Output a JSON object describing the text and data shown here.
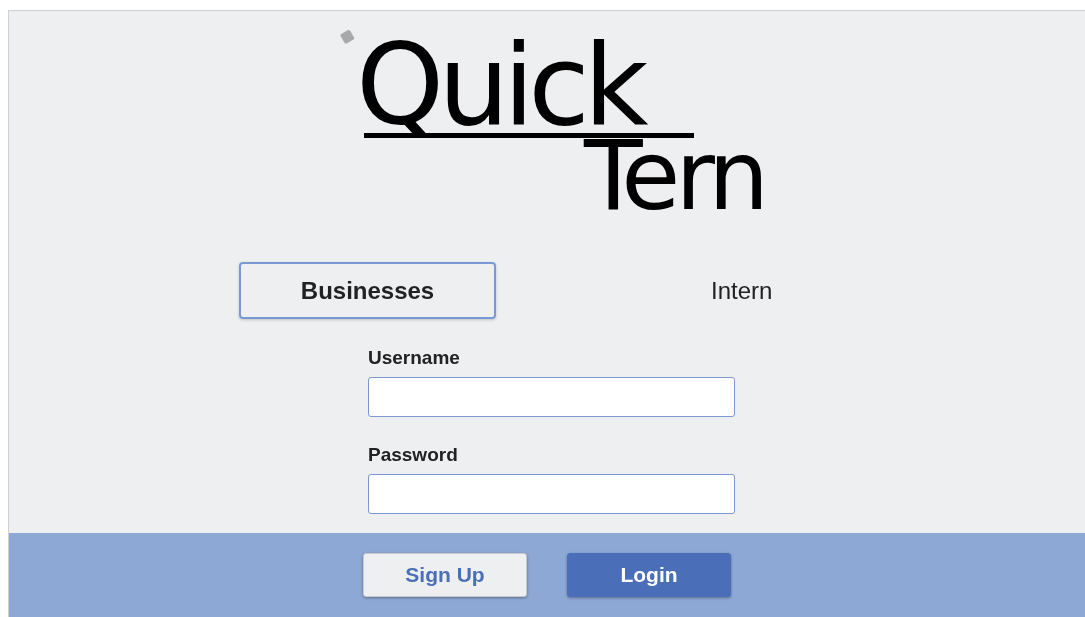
{
  "logo": {
    "line_1": "Quick",
    "line_2": "Tern"
  },
  "tabs": [
    {
      "label": "Businesses",
      "selected": true
    },
    {
      "label": "Intern",
      "selected": false
    }
  ],
  "fields": [
    {
      "label": "Username"
    },
    {
      "label": "Password"
    }
  ],
  "buttons": [
    {
      "label": "Sign Up",
      "kind": "secondary"
    },
    {
      "label": "Login",
      "kind": "primary"
    }
  ]
}
